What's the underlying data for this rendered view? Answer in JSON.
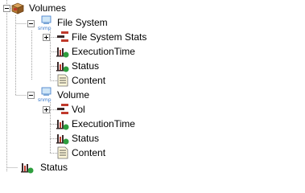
{
  "tree": {
    "nodes": [
      {
        "label": "Volumes",
        "icon": "package-icon"
      },
      {
        "label": "File System",
        "icon": "snmp-monitor-icon"
      },
      {
        "label": "File System Stats",
        "icon": "table-stats-icon"
      },
      {
        "label": "ExecutionTime",
        "icon": "bar-chart-icon"
      },
      {
        "label": "Status",
        "icon": "bar-chart-icon"
      },
      {
        "label": "Content",
        "icon": "document-icon"
      },
      {
        "label": "Volume",
        "icon": "snmp-monitor-icon"
      },
      {
        "label": "Vol",
        "icon": "table-stats-icon"
      },
      {
        "label": "ExecutionTime",
        "icon": "bar-chart-icon"
      },
      {
        "label": "Status",
        "icon": "bar-chart-icon"
      },
      {
        "label": "Content",
        "icon": "document-icon"
      },
      {
        "label": "Status",
        "icon": "bar-chart-icon"
      }
    ],
    "snmp_badge": "snmp"
  },
  "colors": {
    "line": "#a0a0a0",
    "snmp_text": "#3a78c8",
    "bar_red": "#c0392b",
    "bar_dark": "#3a2a2a",
    "badge_green": "#2e9e3e"
  }
}
